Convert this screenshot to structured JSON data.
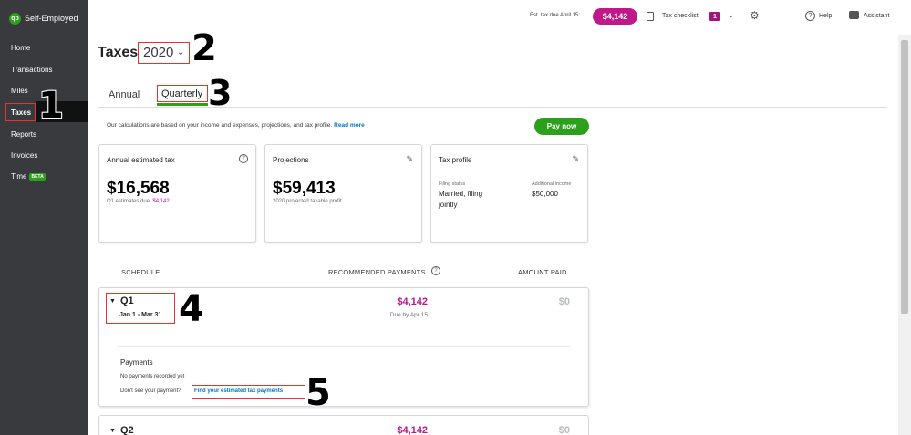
{
  "sidebar": {
    "brand": "Self-Employed",
    "logo_text": "qb",
    "items": [
      {
        "label": "Home"
      },
      {
        "label": "Transactions"
      },
      {
        "label": "Miles"
      },
      {
        "label": "Taxes",
        "active": true
      },
      {
        "label": "Reports"
      },
      {
        "label": "Invoices"
      },
      {
        "label": "Time",
        "badge": "BETA"
      }
    ]
  },
  "topbar": {
    "est_label": "Est. tax due April 15:",
    "est_amount": "$4,142",
    "checklist_label": "Tax checklist",
    "checklist_count": "1",
    "help_label": "Help",
    "assistant_label": "Assistant"
  },
  "page": {
    "title": "Taxes",
    "year": "2020",
    "tabs": [
      {
        "label": "Annual"
      },
      {
        "label": "Quarterly",
        "active": true
      }
    ],
    "info_text": "Our calculations are based on your income and expenses, projections, and tax profile.",
    "info_link": "Read more",
    "pay_button": "Pay now"
  },
  "cards": {
    "annual": {
      "title": "Annual estimated tax",
      "amount": "$16,568",
      "sub_label": "Q1 estimates due:",
      "sub_amount": "$4,142"
    },
    "projections": {
      "title": "Projections",
      "amount": "$59,413",
      "sub_label": "2020 projected taxable profit"
    },
    "tax_profile": {
      "title": "Tax profile",
      "filing_label": "Filing status",
      "filing_value_1": "Married, filing",
      "filing_value_2": "jointly",
      "income_label": "Additional income",
      "income_value": "$50,000"
    }
  },
  "schedule": {
    "headers": {
      "schedule": "SCHEDULE",
      "recommended": "RECOMMENDED PAYMENTS",
      "paid": "AMOUNT PAID"
    },
    "q1": {
      "label": "Q1",
      "range": "Jan 1 - Mar 31",
      "recommended": "$4,142",
      "due": "Due by Apr 15",
      "paid": "$0",
      "payments_heading": "Payments",
      "no_payments": "No payments recorded yet",
      "missing_prompt": "Don't see your payment?",
      "find_link": "Find your estimated tax payments"
    },
    "q2": {
      "label": "Q2",
      "recommended": "$4,142",
      "paid": "$0"
    }
  },
  "annotations": [
    "1",
    "2",
    "3",
    "4",
    "5"
  ],
  "colors": {
    "sidebar_bg": "#393a3d",
    "accent_green": "#2ca01c",
    "magenta": "#c0188a",
    "link_blue": "#0077c5",
    "highlight_red": "#e0342d"
  },
  "icons": [
    "qb-logo-icon",
    "clipboard-icon",
    "chevron-down-icon",
    "gear-icon",
    "help-icon",
    "assistant-icon",
    "question-icon",
    "pencil-icon",
    "caret-down-icon"
  ]
}
